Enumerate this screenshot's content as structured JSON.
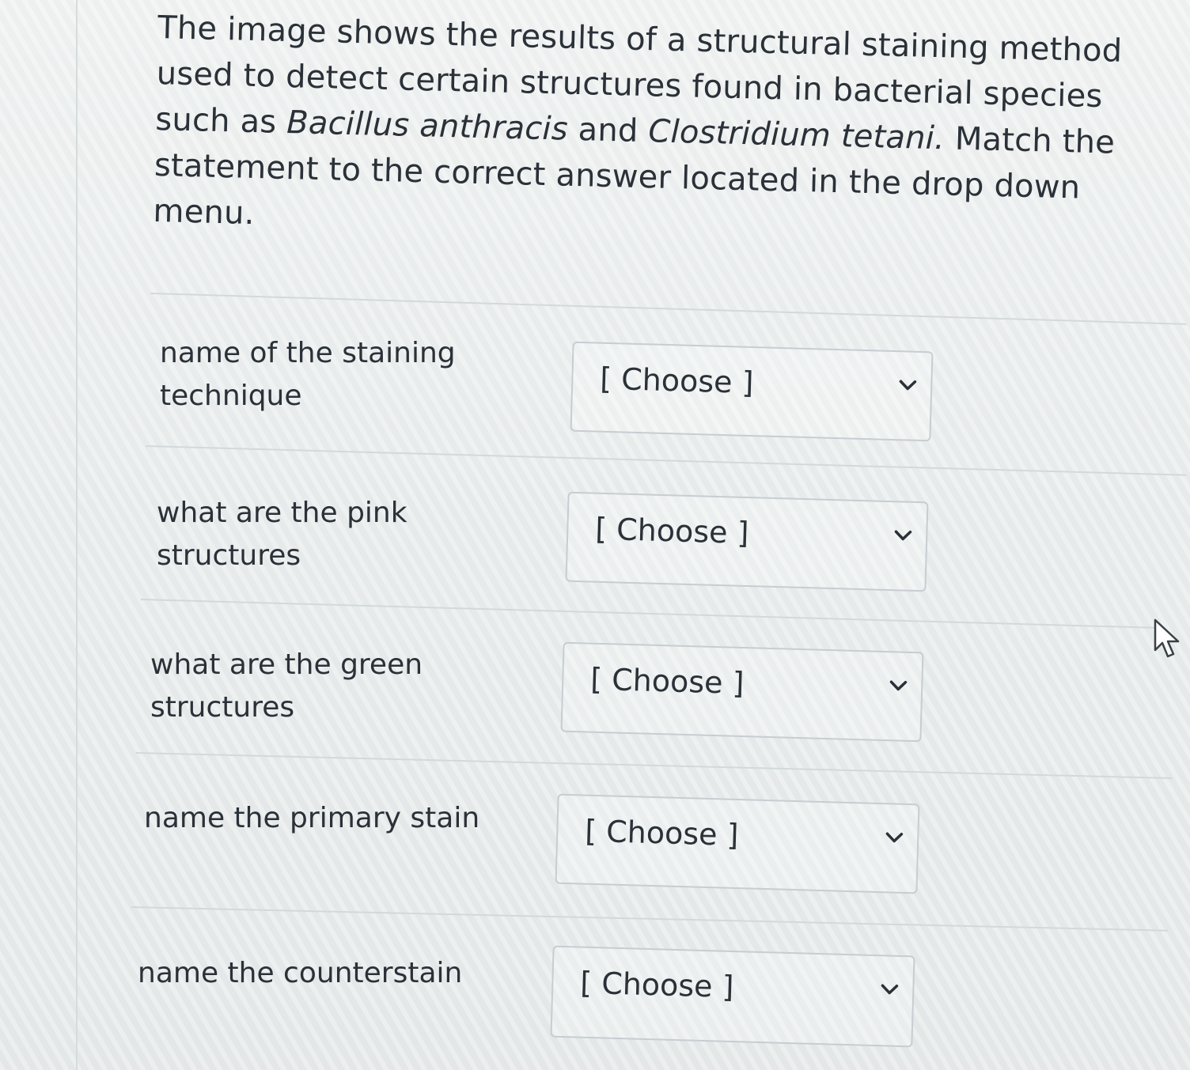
{
  "question": {
    "part1": "The image shows the results of a structural staining method used to detect certain structures found in bacterial species such as ",
    "species1": "Bacillus anthracis",
    "and": " and ",
    "species2": "Clostridium tetani.",
    "part2": " Match the statement to the correct answer located in the drop down menu."
  },
  "rows": [
    {
      "label": "name of the staining technique",
      "select_value": "[ Choose ]"
    },
    {
      "label": "what are the pink structures",
      "select_value": "[ Choose ]"
    },
    {
      "label": "what are the green structures",
      "select_value": "[ Choose ]"
    },
    {
      "label": "name the primary stain",
      "select_value": "[ Choose ]"
    },
    {
      "label": "name the counterstain",
      "select_value": "[ Choose ]"
    }
  ],
  "icons": {
    "dropdown": "chevron-down-icon",
    "cursor": "mouse-pointer-icon"
  }
}
